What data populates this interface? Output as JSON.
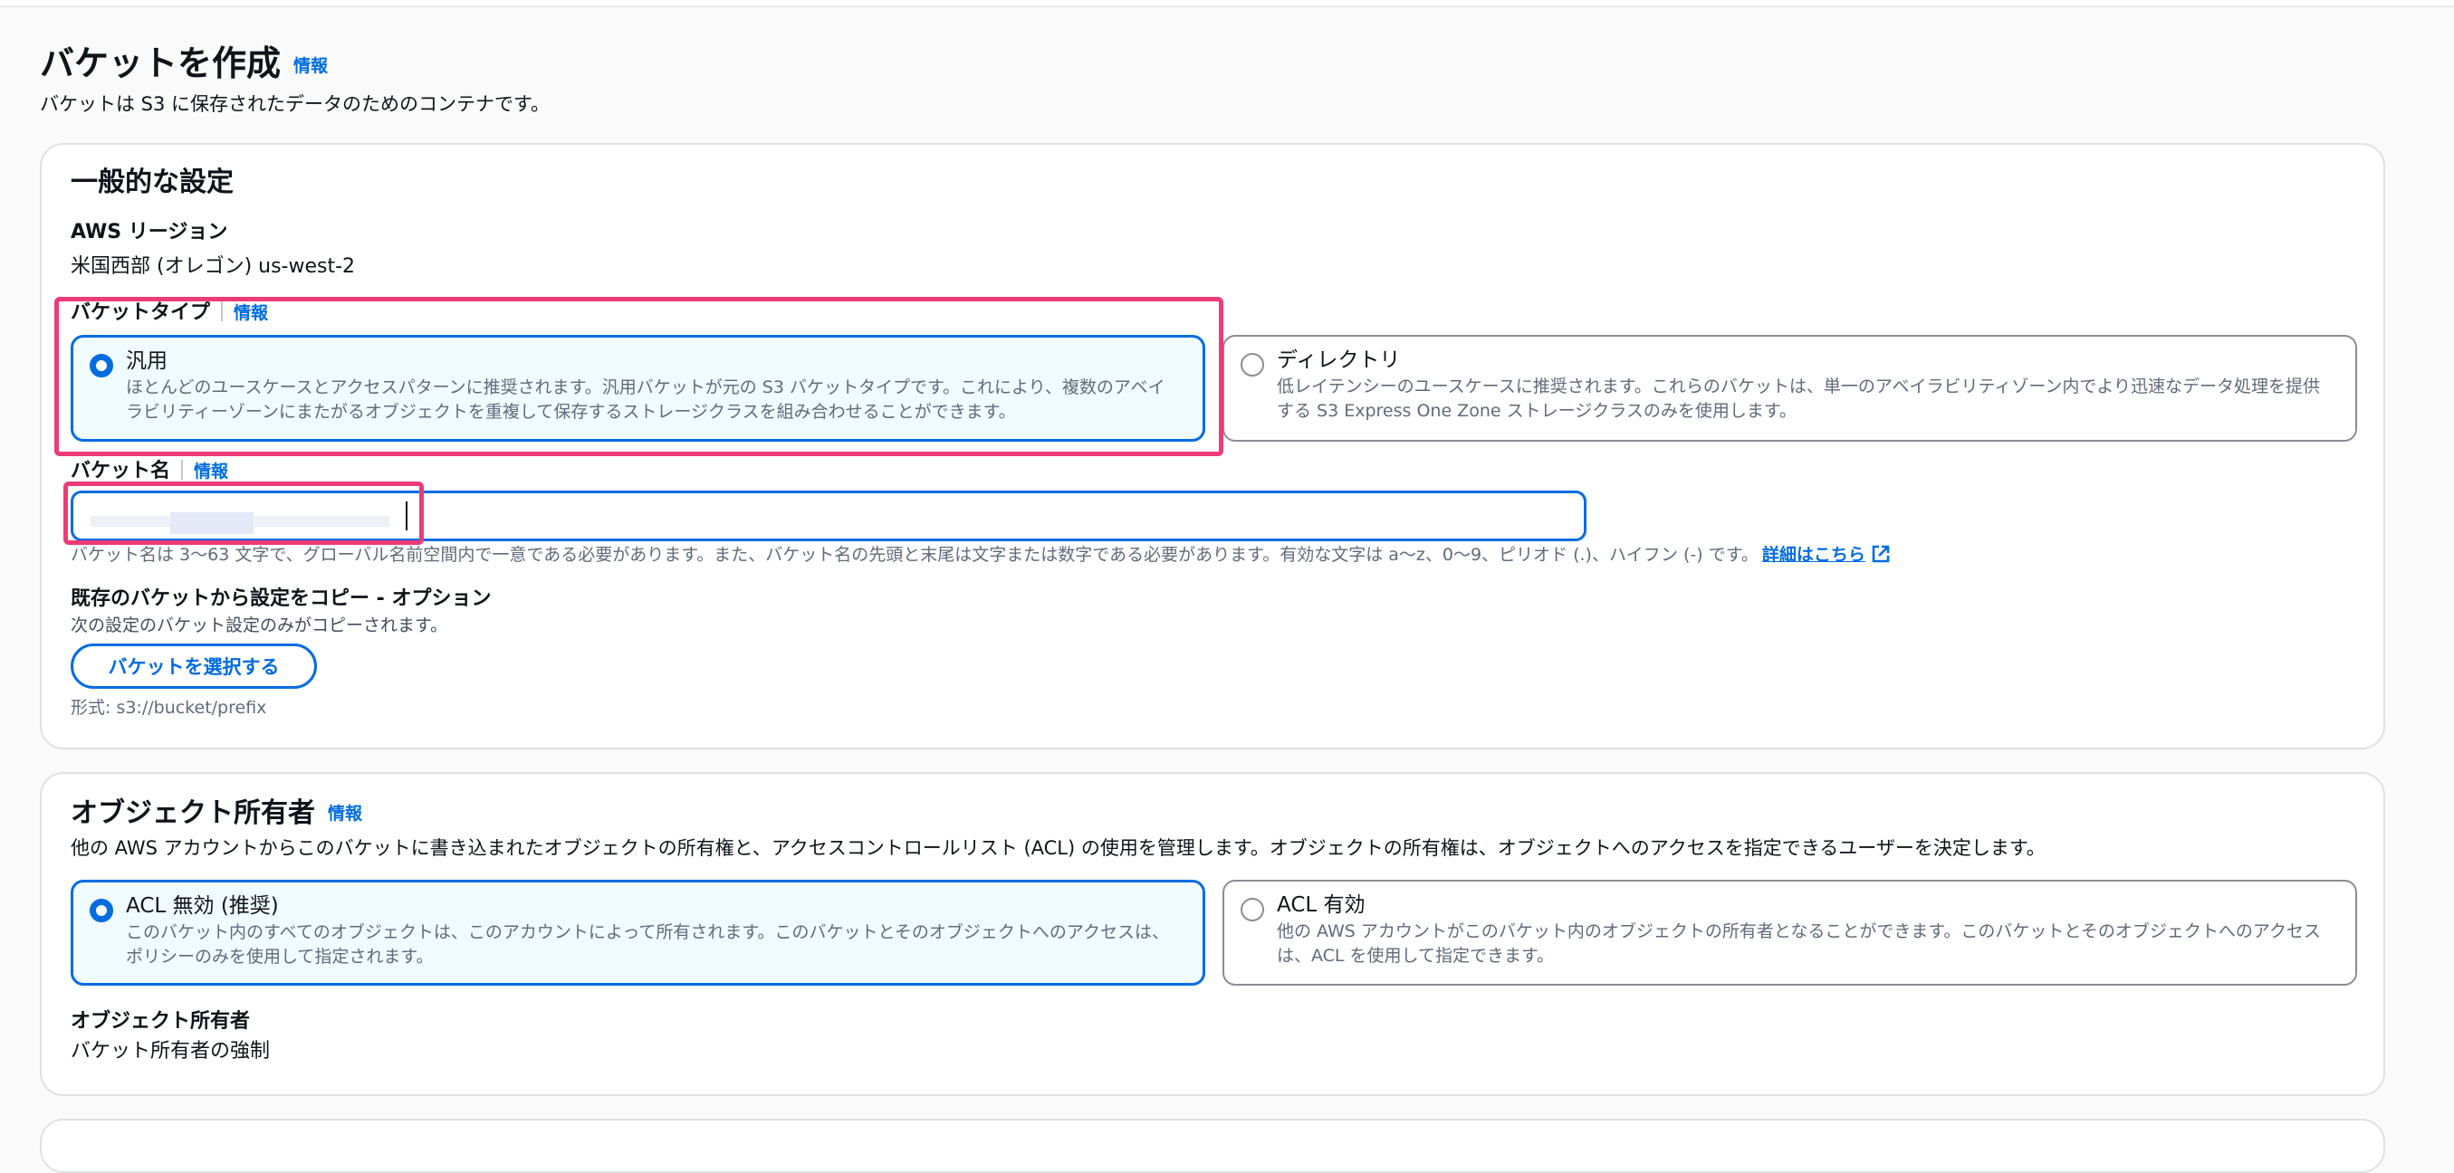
{
  "page": {
    "title": "バケットを作成",
    "title_info": "情報",
    "description": "バケットは S3 に保存されたデータのためのコンテナです。"
  },
  "general": {
    "heading": "一般的な設定",
    "region_label": "AWS リージョン",
    "region_value": "米国西部 (オレゴン) us-west-2",
    "bucket_type": {
      "label": "バケットタイプ",
      "info": "情報",
      "options": [
        {
          "title": "汎用",
          "selected": true,
          "desc_line1": "ほとんどのユースケースとアクセスパターンに推奨されます。汎用バケットが元の S3 バケットタイプです。これにより、複数のアベイ",
          "desc_line2": "ラビリティーゾーンにまたがるオブジェクトを重複して保存するストレージクラスを組み合わせることができます。"
        },
        {
          "title": "ディレクトリ",
          "selected": false,
          "desc_line1": "低レイテンシーのユースケースに推奨されます。これらのバケットは、単一のアベイラビリティゾーン内でより迅速なデータ処理を提供",
          "desc_line2": "する S3 Express One Zone ストレージクラスのみを使用します。"
        }
      ]
    },
    "bucket_name": {
      "label": "バケット名",
      "info": "情報",
      "value": "",
      "hint": "バケット名は 3〜63 文字で、グローバル名前空間内で一意である必要があります。また、バケット名の先頭と末尾は文字または数字である必要があります。有効な文字は a〜z、0〜9、ピリオド (.)、ハイフン (-) です。",
      "hint_link": "詳細はこちら"
    },
    "copy": {
      "label": "既存のバケットから設定をコピー - オプション",
      "desc": "次の設定のバケット設定のみがコピーされます。",
      "button": "バケットを選択する",
      "format": "形式: s3://bucket/prefix"
    }
  },
  "ownership": {
    "heading": "オブジェクト所有者",
    "info": "情報",
    "description": "他の AWS アカウントからこのバケットに書き込まれたオブジェクトの所有権と、アクセスコントロールリスト (ACL) の使用を管理します。オブジェクトの所有権は、オブジェクトへのアクセスを指定できるユーザーを決定します。",
    "options": [
      {
        "title": "ACL 無効 (推奨)",
        "selected": true,
        "desc_line1": "このバケット内のすべてのオブジェクトは、このアカウントによって所有されます。このバケットとそのオブジェクトへのアクセスは、",
        "desc_line2": "ポリシーのみを使用して指定されます。"
      },
      {
        "title": "ACL 有効",
        "selected": false,
        "desc_line1": "他の AWS アカウントがこのバケット内のオブジェクトの所有者となることができます。このバケットとそのオブジェクトへのアクセス",
        "desc_line2": "は、ACL を使用して指定できます。"
      }
    ],
    "owner_label": "オブジェクト所有者",
    "owner_value": "バケット所有者の強制"
  },
  "colors": {
    "accent": "#006ce0",
    "highlight": "#ec3b76",
    "selected_bg": "#f0fbff"
  }
}
